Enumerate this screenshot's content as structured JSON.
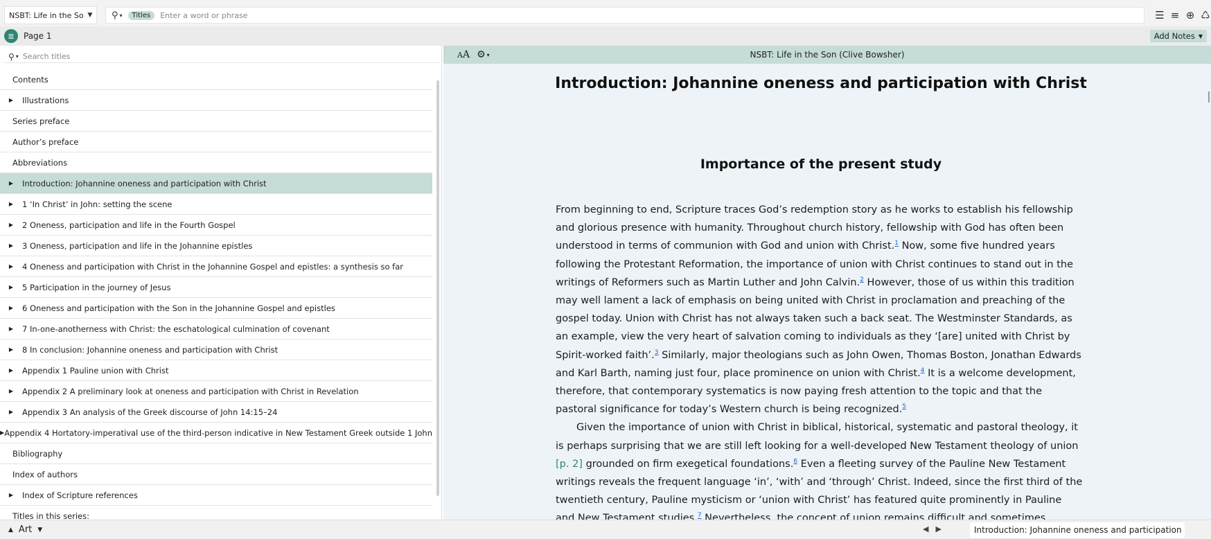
{
  "toolbar": {
    "resource_title": "NSBT: Life in the Son",
    "search_type": "Titles",
    "search_placeholder": "Enter a word or phrase"
  },
  "panel": {
    "title": "Page 1",
    "add_notes": "Add Notes"
  },
  "toc": {
    "search_placeholder": "Search titles",
    "items": [
      {
        "label": "Contents",
        "expandable": false,
        "selected": false
      },
      {
        "label": "Illustrations",
        "expandable": true,
        "selected": false
      },
      {
        "label": "Series preface",
        "expandable": false,
        "selected": false
      },
      {
        "label": "Author’s preface",
        "expandable": false,
        "selected": false
      },
      {
        "label": "Abbreviations",
        "expandable": false,
        "selected": false
      },
      {
        "label": "Introduction: Johannine oneness and participation with Christ",
        "expandable": true,
        "selected": true
      },
      {
        "label": "1 ‘In Christ’ in John: setting the scene",
        "expandable": true,
        "selected": false
      },
      {
        "label": "2 Oneness, participation and life in the Fourth Gospel",
        "expandable": true,
        "selected": false
      },
      {
        "label": "3 Oneness, participation and life in the Johannine epistles",
        "expandable": true,
        "selected": false
      },
      {
        "label": "4 Oneness and participation with Christ in the Johannine Gospel and epistles: a synthesis so far",
        "expandable": true,
        "selected": false
      },
      {
        "label": "5 Participation in the journey of Jesus",
        "expandable": true,
        "selected": false
      },
      {
        "label": "6 Oneness and participation with the Son in the Johannine Gospel and epistles",
        "expandable": true,
        "selected": false
      },
      {
        "label": "7 In-one-anotherness with Christ: the eschatological culmination of covenant",
        "expandable": true,
        "selected": false
      },
      {
        "label": "8 In conclusion: Johannine oneness and participation with Christ",
        "expandable": true,
        "selected": false
      },
      {
        "label": "Appendix 1 Pauline union with Christ",
        "expandable": true,
        "selected": false
      },
      {
        "label": "Appendix 2 A preliminary look at oneness and participation with Christ in Revelation",
        "expandable": true,
        "selected": false
      },
      {
        "label": "Appendix 3 An analysis of the Greek discourse of John 14:15–24",
        "expandable": true,
        "selected": false
      },
      {
        "label": "Appendix 4 Hortatory-imperatival use of the third-person indicative in New Testament Greek outside 1 John",
        "expandable": true,
        "selected": false
      },
      {
        "label": "Bibliography",
        "expandable": false,
        "selected": false
      },
      {
        "label": "Index of authors",
        "expandable": false,
        "selected": false
      },
      {
        "label": "Index of Scripture references",
        "expandable": true,
        "selected": false
      },
      {
        "label": "Titles in this series:",
        "expandable": false,
        "selected": false
      }
    ]
  },
  "reader": {
    "header_title": "NSBT: Life in the Son (Clive Bowsher)",
    "aa_label": "AA",
    "chapter_title": "Introduction: Johannine oneness and participation with Christ",
    "section_title": "Importance of the present study",
    "p1": [
      "From beginning to end, Scripture traces God’s redemption story as he works to establish his fellowship and glorious presence with humanity. Throughout church history, fellowship with God has often been understood in terms of communion with God and union with Christ.",
      "1",
      " Now, some five hundred years following the Protestant Reformation, the importance of union with Christ continues to stand out in the writings of Reformers such as Martin Luther and John Calvin.",
      "2",
      " However, those of us within this tradition may well lament a lack of emphasis on being united with Christ in proclamation and preaching of the gospel today. Union with Christ has not always taken such a back seat. The Westminster Standards, as an example, view the very heart of salvation coming to individuals as they ‘[are] united with Christ by Spirit-worked faith’.",
      "3",
      " Similarly, major theologians such as John Owen, Thomas Boston, Jonathan Edwards and Karl Barth, naming just four, place prominence on union with Christ.",
      "4",
      " It is a welcome development, therefore, that contemporary systematics is now paying fresh attention to the topic and that the pastoral significance for today’s Western church is being recognized.",
      "5"
    ],
    "p2": [
      "Given the importance of union with Christ in biblical, historical, systematic and pastoral theology, it is perhaps surprising that we are still left looking for a well-developed New Testament theology of union ",
      "[p. 2]",
      " grounded on firm exegetical foundations.",
      "6",
      " Even a fleeting survey of the Pauline New Testament writings reveals the frequent language ‘in’, ‘with’ and ‘through’ Christ. Indeed, since the first third of the twentieth century, Pauline mysticism or ‘union with Christ’ has featured quite prominently in Pauline and New Testament studies.",
      "7",
      " Nevertheless, the concept of union remains difficult and sometimes controversial."
    ]
  },
  "bottom": {
    "layout_label": "Art",
    "status_title": "Introduction: Johannine oneness and participation wit..."
  }
}
